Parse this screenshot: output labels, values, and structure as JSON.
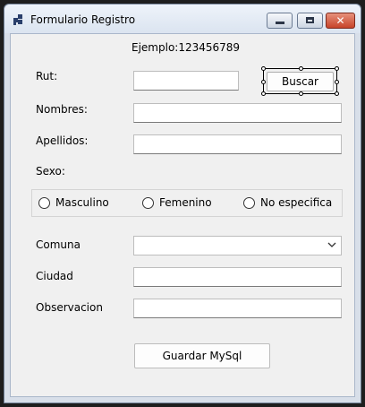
{
  "window": {
    "title": "Formulario Registro"
  },
  "icons": {
    "app": "form-app-icon",
    "minimize": "minimize-icon",
    "maximize": "maximize-icon",
    "close": "close-icon",
    "dropdown": "chevron-down-icon"
  },
  "form": {
    "hint": "Ejemplo:123456789",
    "rut_label": "Rut:",
    "rut_value": "",
    "search_button": "Buscar",
    "nombres_label": "Nombres:",
    "nombres_value": "",
    "apellidos_label": "Apellidos:",
    "apellidos_value": "",
    "sexo_label": "Sexo:",
    "sexo_options": [
      "Masculino",
      "Femenino",
      "No especifica"
    ],
    "comuna_label": "Comuna",
    "comuna_value": "",
    "ciudad_label": "Ciudad",
    "ciudad_value": "",
    "observacion_label": "Observacion",
    "observacion_value": "",
    "save_button": "Guardar MySql"
  },
  "colors": {
    "close_button": "#c7442a",
    "client_bg": "#f0f0f0",
    "titlebar": "#dbe4f0"
  }
}
